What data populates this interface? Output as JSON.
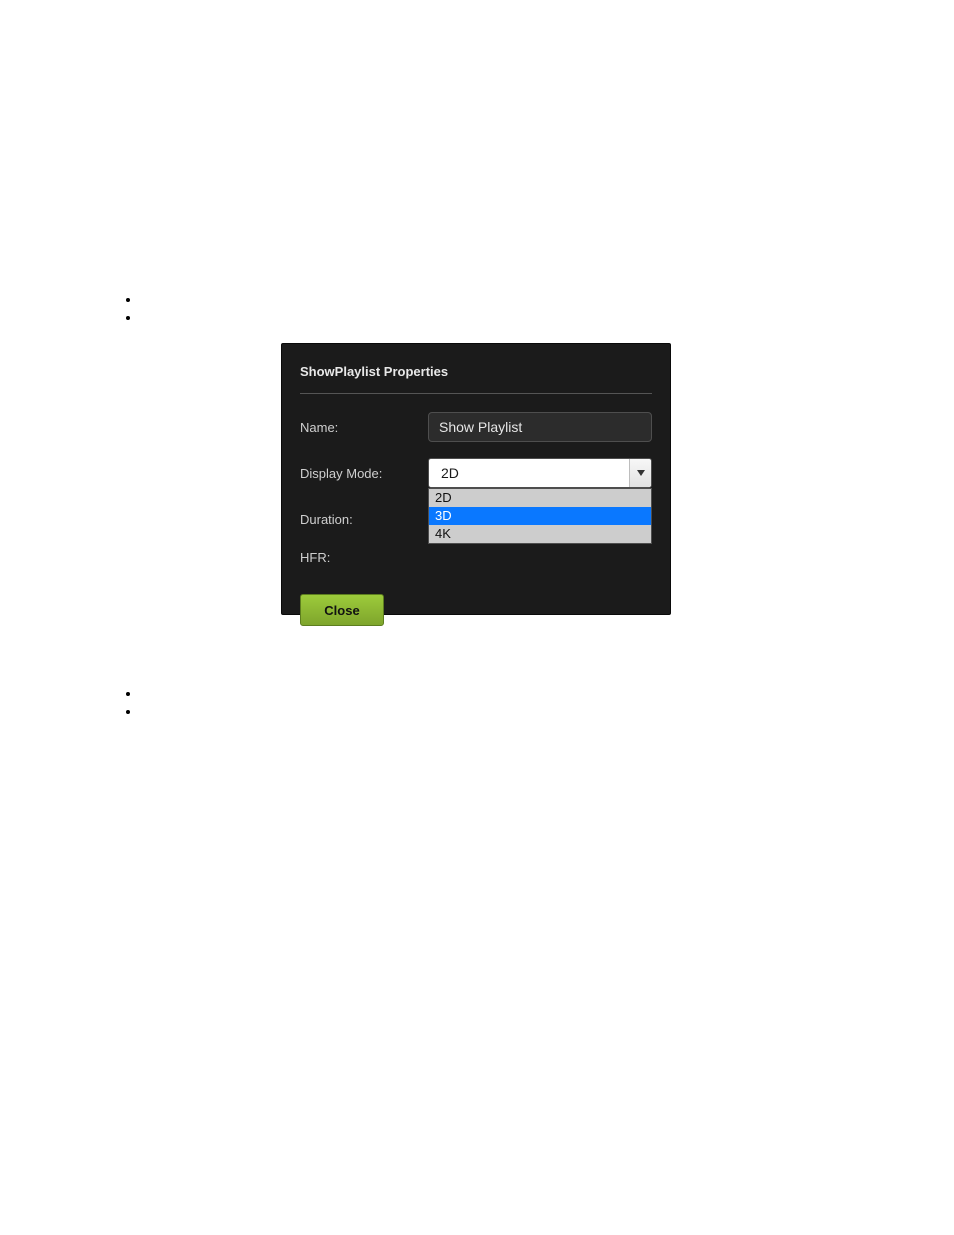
{
  "dialog": {
    "title": "ShowPlaylist Properties",
    "fields": {
      "name": {
        "label": "Name:",
        "value": "Show Playlist"
      },
      "displayMode": {
        "label": "Display Mode:",
        "value": "2D",
        "options": [
          "2D",
          "3D",
          "4K"
        ],
        "highlighted": "3D"
      },
      "duration": {
        "label": "Duration:"
      },
      "hfr": {
        "label": "HFR:"
      }
    },
    "closeLabel": "Close"
  },
  "bullets": {
    "top": [
      "",
      ""
    ],
    "bottom": [
      "",
      ""
    ]
  }
}
